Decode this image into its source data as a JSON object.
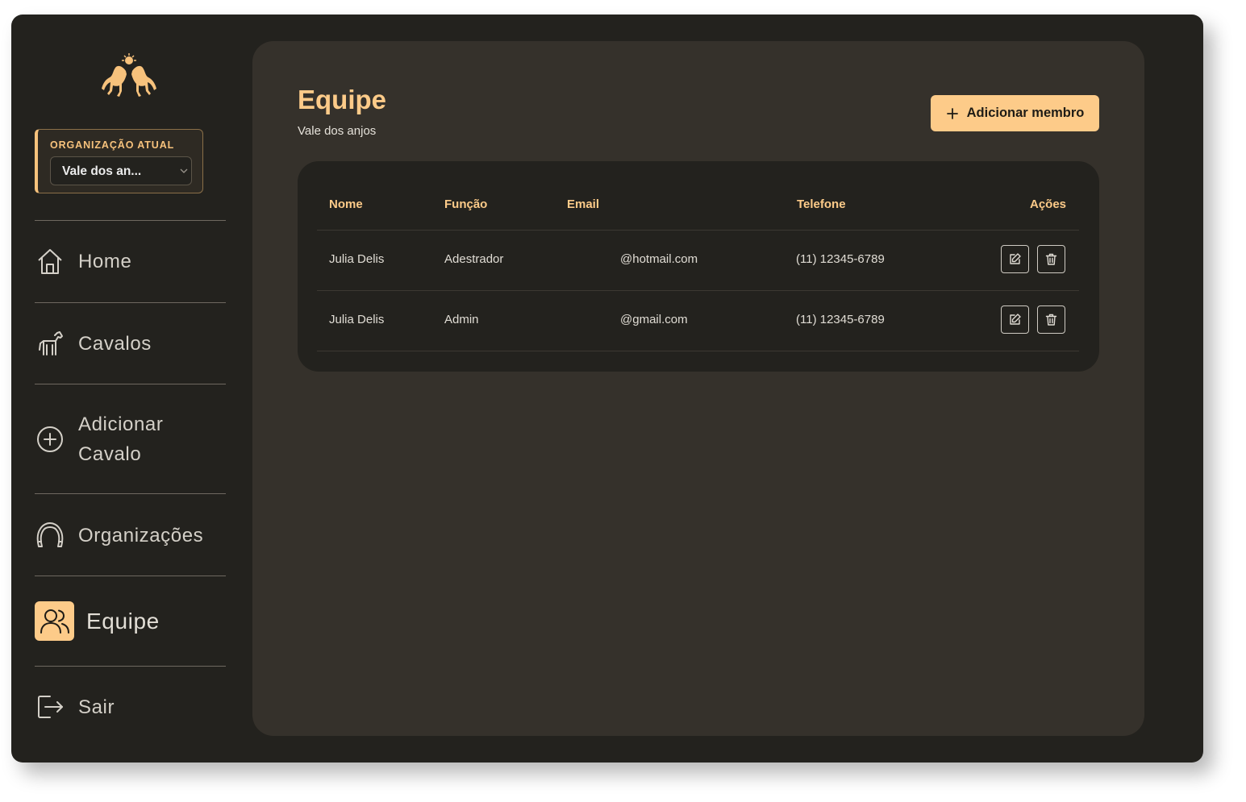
{
  "sidebar": {
    "org_label": "ORGANIZAÇÃO ATUAL",
    "org_selected": "Vale dos an...",
    "items": [
      {
        "label": "Home",
        "icon": "home-icon"
      },
      {
        "label": "Cavalos",
        "icon": "horse-icon"
      },
      {
        "label": "Adicionar Cavalo",
        "icon": "plus-circle-icon"
      },
      {
        "label": "Organizações",
        "icon": "horseshoe-icon"
      },
      {
        "label": "Equipe",
        "icon": "users-icon",
        "active": true
      },
      {
        "label": "Sair",
        "icon": "logout-icon"
      }
    ]
  },
  "main": {
    "title": "Equipe",
    "subtitle": "Vale dos anjos",
    "add_button_label": "Adicionar membro",
    "table": {
      "columns": [
        "Nome",
        "Função",
        "Email",
        "Telefone",
        "Ações"
      ],
      "rows": [
        {
          "nome": "Julia Delis",
          "funcao": "Adestrador",
          "email": "@hotmail.com",
          "telefone": "(11) 12345-6789"
        },
        {
          "nome": "Julia Delis",
          "funcao": "Admin",
          "email": "@gmail.com",
          "telefone": "(11) 12345-6789"
        }
      ]
    }
  },
  "colors": {
    "accent": "#fdcb89",
    "background": "#23221e",
    "panel": "#35312b"
  }
}
